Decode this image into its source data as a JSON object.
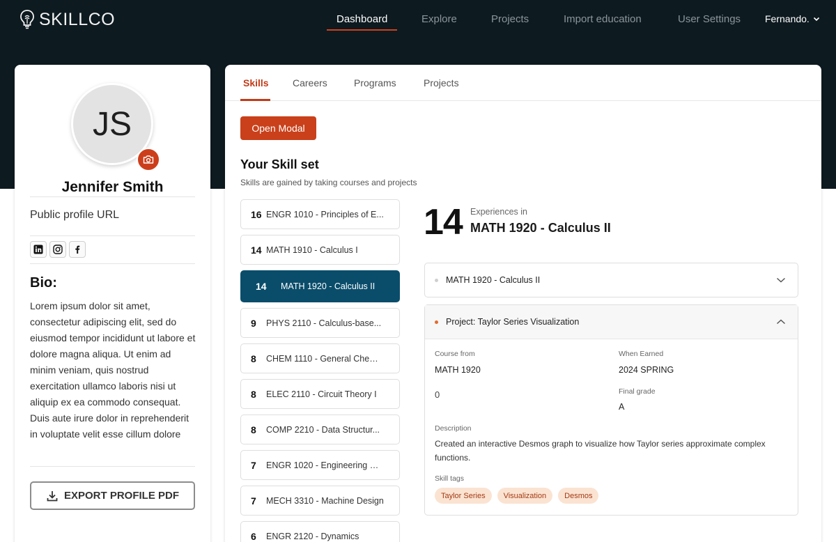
{
  "brand": {
    "name": "SKILLCO"
  },
  "nav": {
    "items": [
      "Dashboard",
      "Explore",
      "Projects",
      "Import education",
      "User Settings"
    ],
    "active": "Dashboard",
    "user": "Fernando."
  },
  "profile": {
    "initials": "JS",
    "name": "Jennifer Smith",
    "public_url_label": "Public profile URL",
    "socials": [
      "linkedin-icon",
      "instagram-icon",
      "facebook-icon"
    ],
    "bio_title": "Bio:",
    "bio": "Lorem ipsum dolor sit amet, consectetur adipiscing elit, sed do eiusmod tempor incididunt ut labore et dolore magna aliqua. Ut enim ad minim veniam, quis nostrud exercitation ullamco laboris nisi ut aliquip ex ea commodo consequat. Duis aute irure dolor in reprehenderit in voluptate velit esse cillum dolore",
    "export_label": "EXPORT PROFILE PDF"
  },
  "tabs": [
    "Skills",
    "Careers",
    "Programs",
    "Projects"
  ],
  "open_modal_label": "Open Modal",
  "skillset": {
    "title": "Your Skill set",
    "subtitle": "Skills are gained by taking courses and projects",
    "items": [
      {
        "count": "16",
        "label": "ENGR 1010 - Principles of E..."
      },
      {
        "count": "14",
        "label": "MATH 1910 - Calculus I"
      },
      {
        "count": "14",
        "label": "MATH 1920 - Calculus II",
        "active": true
      },
      {
        "count": "9",
        "label": "PHYS 2110 - Calculus-base..."
      },
      {
        "count": "8",
        "label": "CHEM 1110 - General Chemi..."
      },
      {
        "count": "8",
        "label": "ELEC 2110 - Circuit Theory I"
      },
      {
        "count": "8",
        "label": "COMP 2210 - Data Structur..."
      },
      {
        "count": "7",
        "label": "ENGR 1020 - Engineering Gr..."
      },
      {
        "count": "7",
        "label": "MECH 3310 - Machine Design"
      },
      {
        "count": "6",
        "label": "ENGR 2120 - Dynamics"
      }
    ]
  },
  "detail": {
    "count": "14",
    "experiences_in": "Experiences in",
    "course": "MATH 1920 - Calculus II",
    "accordion1": {
      "title": "MATH 1920 - Calculus II"
    },
    "accordion2": {
      "title": "Project: Taylor Series Visualization",
      "course_from_label": "Course from",
      "course_from": "MATH 1920",
      "when_earned_label": "When Earned",
      "when_earned": "2024 SPRING",
      "extra_value": "0",
      "final_grade_label": "Final grade",
      "final_grade": "A",
      "description_label": "Description",
      "description": "Created an interactive Desmos graph to visualize how Taylor series approximate complex functions.",
      "skill_tags_label": "Skill tags",
      "tags": [
        "Taylor Series",
        "Visualization",
        "Desmos"
      ]
    }
  },
  "colors": {
    "header_bg": "#0d1a20",
    "accent": "#c9401b",
    "selected": "#0a4d6b",
    "tag_bg": "#fbe3d2"
  }
}
